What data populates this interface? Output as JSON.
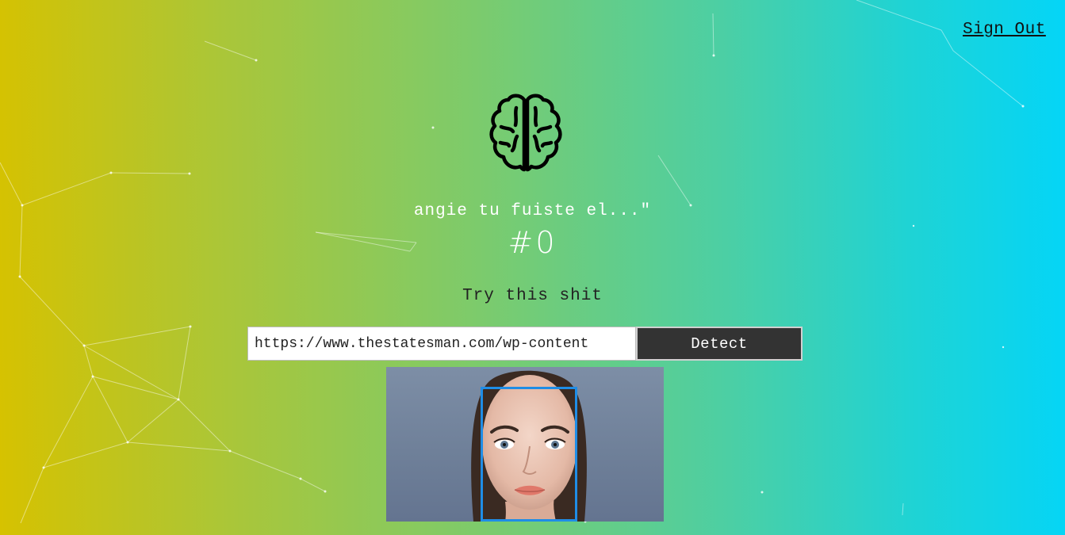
{
  "header": {
    "signout_label": "Sign Out"
  },
  "logo": {
    "icon": "brain-icon"
  },
  "main": {
    "greeting": "angie tu fuiste el...\"",
    "rank": "#0",
    "prompt": "Try this shit"
  },
  "form": {
    "url_value": "https://www.thestatesman.com/wp-content",
    "button_label": "Detect"
  },
  "result": {
    "face_box_color": "#1f8de6"
  },
  "colors": {
    "gradient_start": "#d6c200",
    "gradient_end": "#04d5f7",
    "button_bg": "#333333"
  }
}
